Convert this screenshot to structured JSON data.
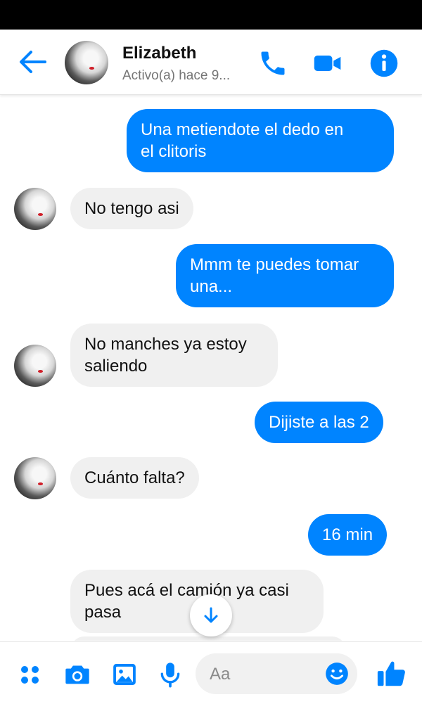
{
  "colors": {
    "accent": "#0084ff",
    "incoming_bubble": "#f0f0f0"
  },
  "header": {
    "contact_name": "Elizabeth",
    "presence": "Activo(a) hace 9...",
    "icons": [
      "back-arrow-icon",
      "phone-icon",
      "video-camera-icon",
      "info-icon"
    ]
  },
  "messages": [
    {
      "direction": "outgoing",
      "text": "Una metiendote el dedo en\nel clitoris"
    },
    {
      "direction": "incoming",
      "text": "No tengo asi"
    },
    {
      "direction": "outgoing",
      "text": "Mmm te puedes tomar\nuna..."
    },
    {
      "direction": "incoming",
      "text": "No manches ya estoy\nsaliendo"
    },
    {
      "direction": "outgoing",
      "text": "Dijiste a las 2"
    },
    {
      "direction": "incoming",
      "text": "Cuánto falta?"
    },
    {
      "direction": "outgoing",
      "text": "16 min"
    },
    {
      "direction": "incoming",
      "text": "Pues acá el camión ya casi\npasa"
    }
  ],
  "composer": {
    "placeholder": "Aa",
    "icons": [
      "apps-grid-icon",
      "camera-icon",
      "gallery-icon",
      "microphone-icon",
      "emoji-icon",
      "like-thumb-icon"
    ]
  }
}
